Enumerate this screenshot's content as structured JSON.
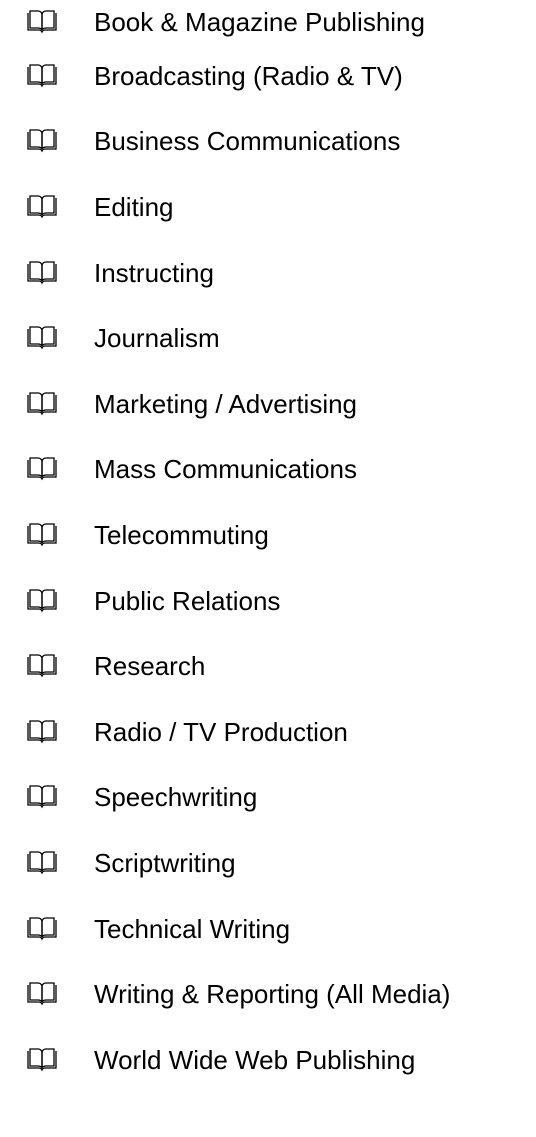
{
  "list": {
    "items": [
      {
        "label": "Book & Magazine Publishing",
        "icon": "open-book-icon"
      },
      {
        "label": "Broadcasting (Radio & TV)",
        "icon": "open-book-icon"
      },
      {
        "label": "Business Communications",
        "icon": "open-book-icon"
      },
      {
        "label": "Editing",
        "icon": "open-book-icon"
      },
      {
        "label": "Instructing",
        "icon": "open-book-icon"
      },
      {
        "label": "Journalism",
        "icon": "open-book-icon"
      },
      {
        "label": "Marketing / Advertising",
        "icon": "open-book-icon"
      },
      {
        "label": "Mass Communications",
        "icon": "open-book-icon"
      },
      {
        "label": "Telecommuting",
        "icon": "open-book-icon"
      },
      {
        "label": "Public Relations",
        "icon": "open-book-icon"
      },
      {
        "label": "Research",
        "icon": "open-book-icon"
      },
      {
        "label": "Radio / TV Production",
        "icon": "open-book-icon"
      },
      {
        "label": "Speechwriting",
        "icon": "open-book-icon"
      },
      {
        "label": "Scriptwriting",
        "icon": "open-book-icon"
      },
      {
        "label": "Technical Writing",
        "icon": "open-book-icon"
      },
      {
        "label": "Writing & Reporting (All Media)",
        "icon": "open-book-icon"
      },
      {
        "label": "World Wide Web Publishing",
        "icon": "open-book-icon"
      }
    ]
  }
}
